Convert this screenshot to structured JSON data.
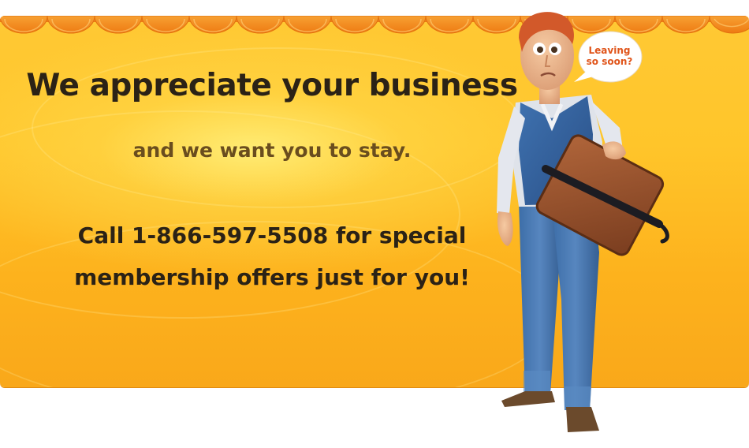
{
  "banner": {
    "headline": "We appreciate your business",
    "subheadline": "and we want you to stay.",
    "offer_line_1": "Call 1-866-597-5508 for special",
    "offer_line_2": "membership offers just for you!"
  },
  "character": {
    "speech_bubble_line_1": "Leaving",
    "speech_bubble_line_2": "so soon?"
  },
  "colors": {
    "background": "#ffc52a",
    "scallop": "#f48a1a",
    "headline": "#2b2216",
    "subheadline": "#6a4d1e",
    "bubble_text": "#e0551b"
  }
}
